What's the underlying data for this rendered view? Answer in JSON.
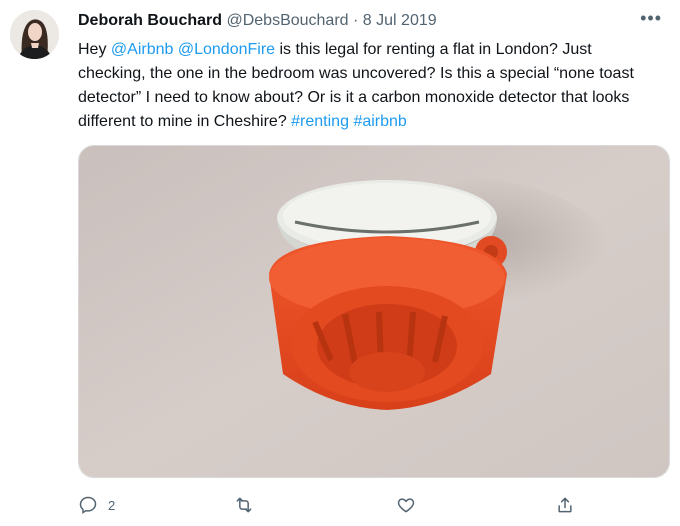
{
  "tweet": {
    "author_name": "Deborah Bouchard",
    "handle": "@DebsBouchard",
    "separator": "·",
    "date": "8 Jul 2019",
    "text_1": "Hey ",
    "mention_1": "@Airbnb",
    "text_2": " ",
    "mention_2": "@LondonFire",
    "text_3": " is this  legal for renting a flat in London? Just checking, the one in the bedroom was uncovered? Is this a special “none toast detector” I need to know about? Or is it a carbon monoxide detector that looks different to mine in Cheshire? ",
    "hashtag_1": "#renting",
    "text_4": " ",
    "hashtag_2": "#airbnb",
    "more_label": "•••"
  },
  "actions": {
    "reply_count": "2"
  },
  "icons": {
    "more": "more-horizontal-icon",
    "reply": "reply-icon",
    "retweet": "retweet-icon",
    "like": "heart-icon",
    "share": "share-icon"
  },
  "colors": {
    "link": "#1d9bf0",
    "muted": "#536471",
    "text": "#0f1419",
    "detector_red": "#e8481f"
  }
}
